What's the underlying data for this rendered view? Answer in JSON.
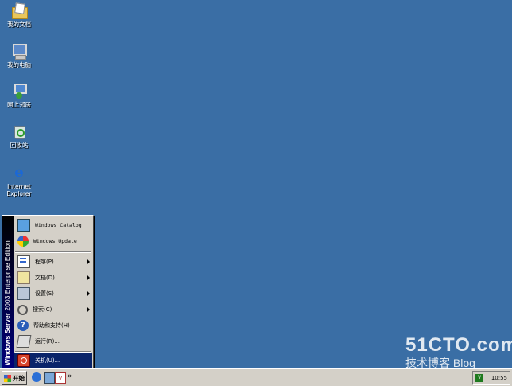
{
  "desktop": {
    "icons": [
      {
        "label": "我的文档",
        "icon": "my-documents-icon"
      },
      {
        "label": "我的电脑",
        "icon": "my-computer-icon"
      },
      {
        "label": "网上邻居",
        "icon": "network-places-icon"
      },
      {
        "label": "回收站",
        "icon": "recycle-bin-icon"
      },
      {
        "label": "Internet\nExplorer",
        "icon": "internet-explorer-icon"
      }
    ]
  },
  "start_menu": {
    "banner": "Windows Server 2003 Enterprise Edition",
    "banner_strong": "Windows Server",
    "banner_rest": " 2003 Enterprise Edition",
    "items": [
      {
        "label": "Windows Catalog",
        "icon": "windows-catalog-icon"
      },
      {
        "label": "Windows Update",
        "icon": "windows-update-icon"
      },
      {
        "label": "程序(P)",
        "icon": "programs-icon"
      },
      {
        "label": "文档(D)",
        "icon": "documents-icon"
      },
      {
        "label": "设置(S)",
        "icon": "settings-icon"
      },
      {
        "label": "搜索(C)",
        "icon": "search-icon"
      },
      {
        "label": "帮助和支持(H)",
        "icon": "help-icon"
      },
      {
        "label": "运行(R)...",
        "icon": "run-icon"
      },
      {
        "label": "关机(U)...",
        "icon": "shutdown-icon"
      }
    ]
  },
  "taskbar": {
    "start_label": "开始",
    "overflow": "»",
    "tray_time": "10:55",
    "tray_badge": "V"
  },
  "watermark": {
    "site": "51CTO.com",
    "tagline": "技术博客 Blog"
  },
  "colors": {
    "desktop": "#3a6ea5",
    "menu_highlight": "#0a246a"
  }
}
